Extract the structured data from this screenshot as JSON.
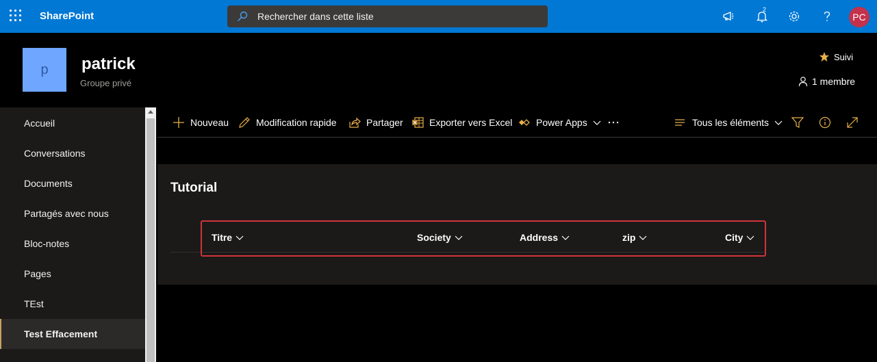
{
  "suitebar": {
    "app_name": "SharePoint",
    "search_placeholder": "Rechercher dans cette liste",
    "notification_count": "2",
    "avatar_initials": "PC",
    "bar_color": "#0078d4"
  },
  "site": {
    "logo_letter": "p",
    "title": "patrick",
    "subtitle": "Groupe privé",
    "follow_label": "Suivi",
    "members_label": "1 membre"
  },
  "nav": {
    "items": [
      {
        "label": "Accueil"
      },
      {
        "label": "Conversations"
      },
      {
        "label": "Documents"
      },
      {
        "label": "Partagés avec nous"
      },
      {
        "label": "Bloc-notes"
      },
      {
        "label": "Pages"
      },
      {
        "label": "TEst"
      },
      {
        "label": "Test Effacement"
      }
    ],
    "active_index": 7
  },
  "commandbar": {
    "new_label": "Nouveau",
    "quick_edit_label": "Modification rapide",
    "share_label": "Partager",
    "export_label": "Exporter vers Excel",
    "powerapps_label": "Power Apps",
    "view_label": "Tous les éléments"
  },
  "list": {
    "title": "Tutorial",
    "columns": [
      {
        "label": "Titre"
      },
      {
        "label": "Society"
      },
      {
        "label": "Address"
      },
      {
        "label": "zip"
      },
      {
        "label": "City"
      }
    ]
  },
  "icons": {
    "app_launcher": "waffle-icon",
    "search": "search-icon",
    "megaphone": "megaphone-icon",
    "bell": "bell-icon",
    "settings": "gear-icon",
    "help": "help-icon",
    "star": "star-icon",
    "person": "person-icon"
  }
}
